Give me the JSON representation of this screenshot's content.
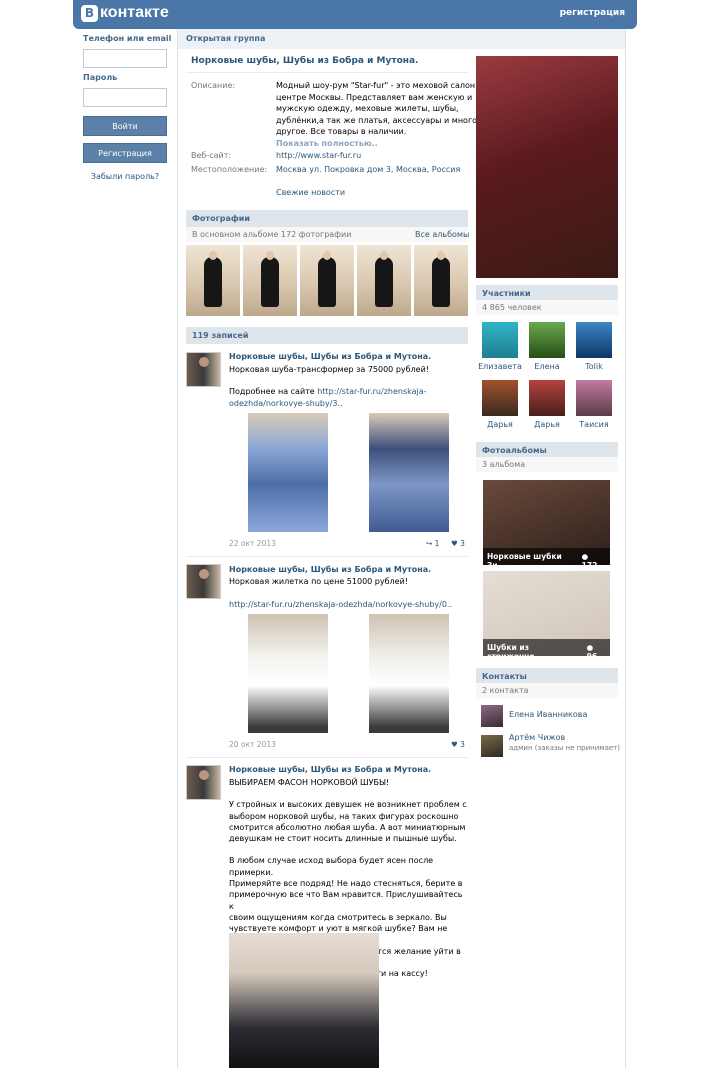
{
  "header": {
    "logo_letter": "В",
    "logo_text": "контакте",
    "register": "регистрация"
  },
  "login": {
    "phone_label": "Телефон или email",
    "password_label": "Пароль",
    "login_button": "Войти",
    "register_button": "Регистрация",
    "forgot": "Забыли пароль?"
  },
  "group": {
    "type": "Открытая группа",
    "name": "Норковые шубы, Шубы из Бобра и Мутона.",
    "info": {
      "desc_label": "Описание:",
      "desc_lines": [
        "Модный шоу-рум \"Star-fur\" - это меховой салон в",
        "центре Москвы. Представляет вам женскую и",
        "мужскую одежду, меховые жилеты, шубы,",
        "дублёнки,а так же платья, аксессуары и многое",
        "другое. Все товары в наличии."
      ],
      "show_more": "Показать полностью..",
      "site_label": "Веб-сайт:",
      "site": "http://www.star-fur.ru",
      "loc_label": "Местоположение:",
      "loc": "Москва ул. Покровка дом 3, Москва, Россия",
      "news": "Свежие новости"
    }
  },
  "photos": {
    "title": "Фотографии",
    "subtitle": "В основном альбоме 172 фотографии",
    "all": "Все альбомы"
  },
  "wall": {
    "count": "119 записей",
    "posts": [
      {
        "author": "Норковые шубы, Шубы из Бобра и Мутона.",
        "lines": [
          "Норковая шуба-трансформер за 75000 рублей!",
          "",
          "Подробнее на сайте"
        ],
        "link1": "http://star-fur.ru/zhenskaja-",
        "link2": "odezhda/norkovye-shuby/3..",
        "date": "22 окт 2013",
        "shares": "1",
        "likes": "3"
      },
      {
        "author": "Норковые шубы, Шубы из Бобра и Мутона.",
        "lines": [
          "Норковая жилетка по цене 51000 рублей!"
        ],
        "link1": "http://star-fur.ru/zhenskaja-odezhda/norkovye-shuby/0..",
        "date": "20 окт 2013",
        "likes": "3"
      },
      {
        "author": "Норковые шубы, Шубы из Бобра и Мутона.",
        "lines": [
          "ВЫБИРАЕМ ФАСОН НОРКОВОЙ ШУБЫ!",
          "",
          "У стройных и высоких девушек не возникнет проблем с",
          "выбором норковой шубы, на таких фигурах роскошно",
          "смотрится абсолютно любая шуба. А вот миниатюрным",
          "девушкам не стоит носить длинные и пышные шубы.",
          "",
          "В любом случае исход выбора будет ясен после примерки.",
          "Примеряйте все подряд! Не надо стесняться, берите в",
          "примерочную все что Вам нравится. Прислушивайтесь к",
          "своим ощущениям когда смотритесь в зеркало. Вы",
          "чувствуете комфорт и уют в мягкой шубке? Вам не хочется",
          "её снимать и внутри Вас просыпается желание уйти в ней?",
          "Тогда выбор сделан - просим пройти на кассу!"
        ]
      }
    ]
  },
  "members": {
    "title": "Участники",
    "count": "4 865 человек",
    "list": [
      "Елизавета",
      "Елена",
      "Tolik",
      "Дарья",
      "Дарья",
      "Таисия"
    ]
  },
  "albums": {
    "title": "Фотоальбомы",
    "count": "3 альбома",
    "list": [
      {
        "name": "Норковые шубки Зи...",
        "n": "172"
      },
      {
        "name": "Шубки из стриженно...",
        "n": "96"
      }
    ]
  },
  "contacts": {
    "title": "Контакты",
    "count": "2 контакта",
    "list": [
      {
        "name": "Елена Иванникова",
        "role": ""
      },
      {
        "name": "Артём Чижов",
        "role": "админ (заказы не принимает)"
      }
    ]
  }
}
